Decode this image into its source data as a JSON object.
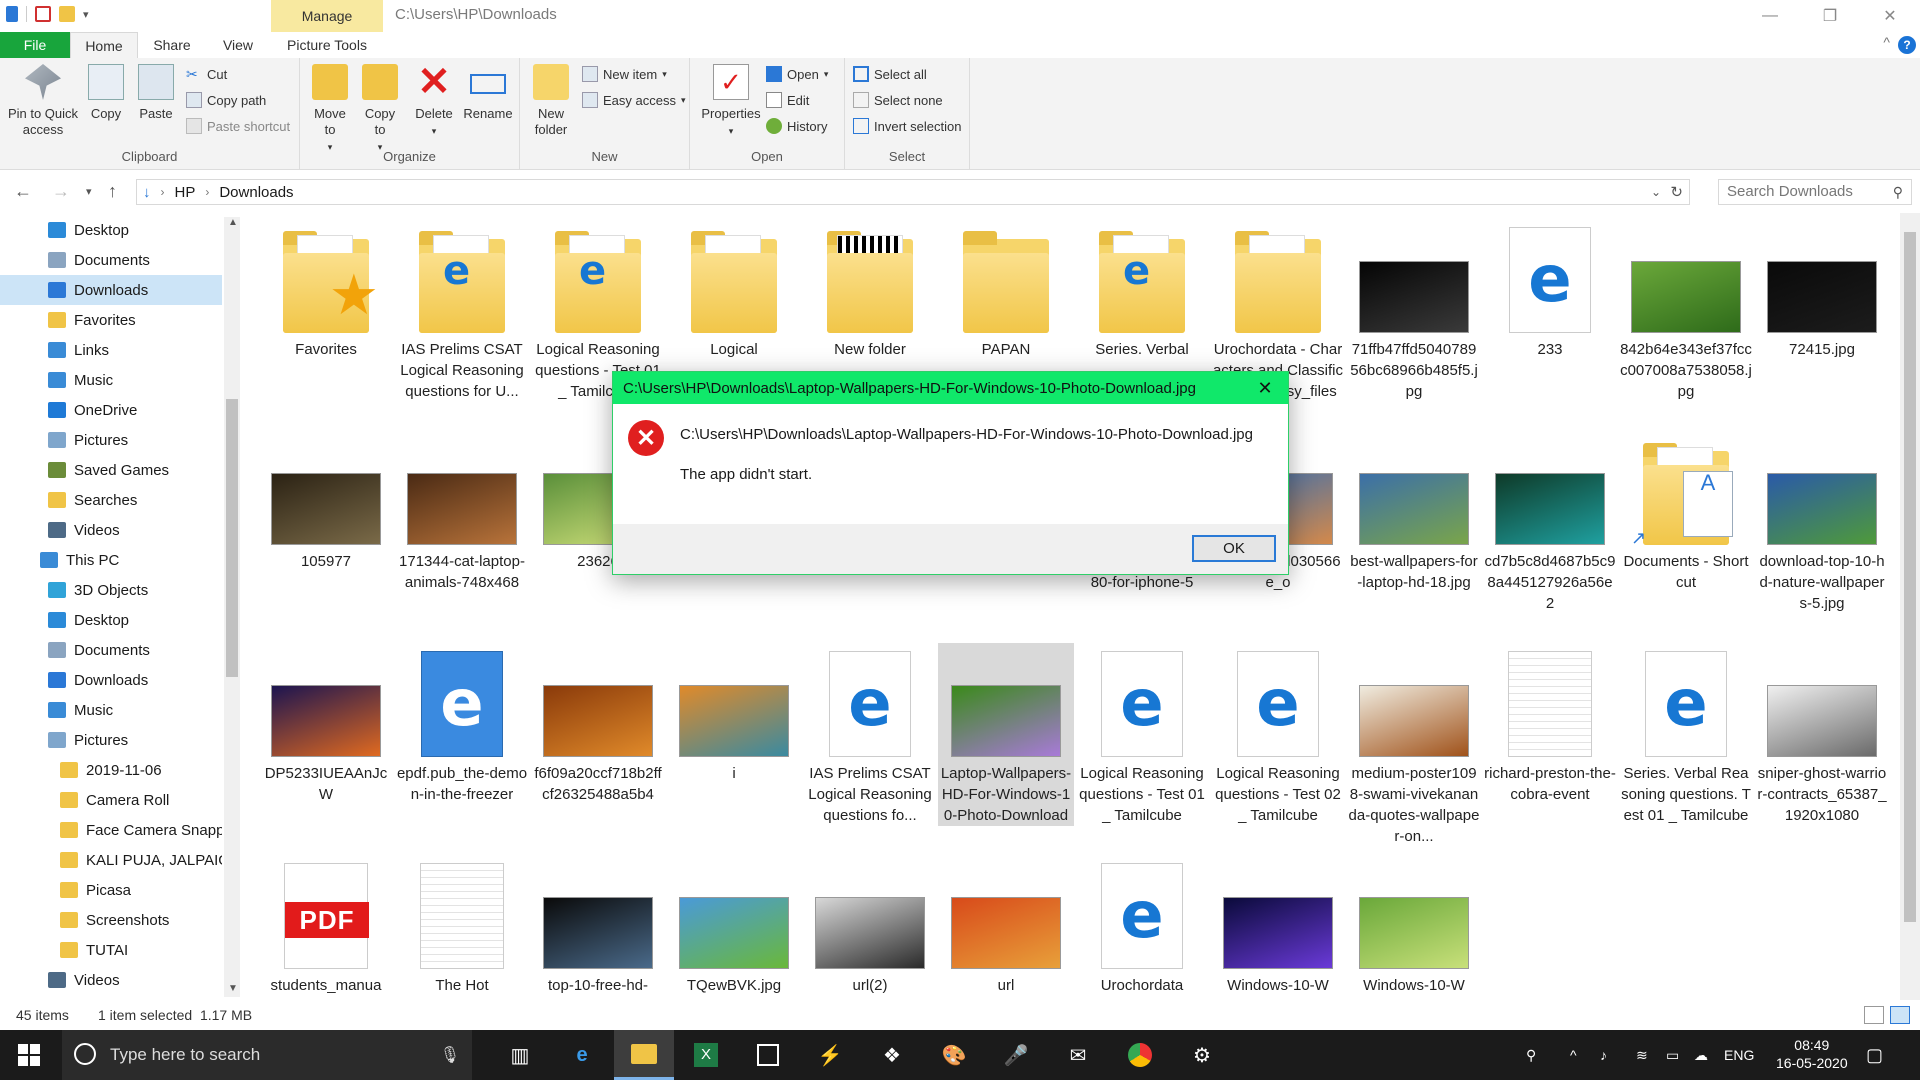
{
  "window": {
    "title_path": "C:\\Users\\HP\\Downloads",
    "manage_label": "Manage",
    "minimize": "—",
    "maximize": "❐",
    "close": "✕"
  },
  "tabs": {
    "file": "File",
    "home": "Home",
    "share": "Share",
    "view": "View",
    "picture_tools": "Picture Tools",
    "help": "?"
  },
  "ribbon": {
    "clipboard": {
      "label": "Clipboard",
      "pin": "Pin to Quick access",
      "copy": "Copy",
      "paste": "Paste",
      "cut": "Cut",
      "copy_path": "Copy path",
      "paste_shortcut": "Paste shortcut"
    },
    "organize": {
      "label": "Organize",
      "move_to": "Move to",
      "copy_to": "Copy to",
      "delete": "Delete",
      "rename": "Rename"
    },
    "new": {
      "label": "New",
      "new_folder": "New folder",
      "new_item": "New item",
      "easy_access": "Easy access"
    },
    "open": {
      "label": "Open",
      "properties": "Properties",
      "open": "Open",
      "edit": "Edit",
      "history": "History"
    },
    "select": {
      "label": "Select",
      "select_all": "Select all",
      "select_none": "Select none",
      "invert": "Invert selection"
    }
  },
  "address": {
    "crumb1": "HP",
    "crumb2": "Downloads",
    "search_placeholder": "Search Downloads"
  },
  "sidebar": {
    "items": [
      {
        "label": "Desktop",
        "icon": "desktop-icon",
        "color": "#2b8ad8"
      },
      {
        "label": "Documents",
        "icon": "documents-icon",
        "color": "#8aa4c0"
      },
      {
        "label": "Downloads",
        "icon": "downloads-icon",
        "color": "#2b78d6"
      },
      {
        "label": "Favorites",
        "icon": "folder-icon",
        "color": "#f0c446"
      },
      {
        "label": "Links",
        "icon": "links-icon",
        "color": "#3a8bd6"
      },
      {
        "label": "Music",
        "icon": "music-icon",
        "color": "#3a8bd6"
      },
      {
        "label": "OneDrive",
        "icon": "onedrive-icon",
        "color": "#1f7ad6"
      },
      {
        "label": "Pictures",
        "icon": "pictures-icon",
        "color": "#7fa6cc"
      },
      {
        "label": "Saved Games",
        "icon": "saved-games-icon",
        "color": "#6b8c3a"
      },
      {
        "label": "Searches",
        "icon": "searches-icon",
        "color": "#f0c446"
      },
      {
        "label": "Videos",
        "icon": "videos-icon",
        "color": "#4d6a86"
      },
      {
        "label": "This PC",
        "icon": "this-pc-icon",
        "color": "#3a8bd6"
      },
      {
        "label": "3D Objects",
        "icon": "3d-objects-icon",
        "color": "#30a3d8"
      },
      {
        "label": "Desktop",
        "icon": "desktop-icon",
        "color": "#2b8ad8"
      },
      {
        "label": "Documents",
        "icon": "documents-icon",
        "color": "#8aa4c0"
      },
      {
        "label": "Downloads",
        "icon": "downloads-icon",
        "color": "#2b78d6"
      },
      {
        "label": "Music",
        "icon": "music-icon",
        "color": "#3a8bd6"
      },
      {
        "label": "Pictures",
        "icon": "pictures-icon",
        "color": "#7fa6cc"
      },
      {
        "label": "2019-11-06",
        "icon": "folder-icon",
        "color": "#f0c446"
      },
      {
        "label": "Camera Roll",
        "icon": "folder-icon",
        "color": "#f0c446"
      },
      {
        "label": "Face Camera Snappy",
        "icon": "folder-icon",
        "color": "#f0c446"
      },
      {
        "label": "KALI PUJA, JALPAIGU",
        "icon": "folder-icon",
        "color": "#f0c446"
      },
      {
        "label": "Picasa",
        "icon": "folder-icon",
        "color": "#f0c446"
      },
      {
        "label": "Screenshots",
        "icon": "folder-icon",
        "color": "#f0c446"
      },
      {
        "label": "TUTAI",
        "icon": "folder-icon",
        "color": "#f0c446"
      },
      {
        "label": "Videos",
        "icon": "videos-icon",
        "color": "#4d6a86"
      }
    ]
  },
  "files": [
    {
      "name": "Favorites",
      "kind": "folder-star"
    },
    {
      "name": "IAS Prelims CSAT Logical Reasoning questions for U...",
      "kind": "folder-edge"
    },
    {
      "name": "Logical Reasoning questions - Test 01 _ Tamilcube",
      "kind": "folder-edge"
    },
    {
      "name": "Logical",
      "kind": "folder"
    },
    {
      "name": "New folder",
      "kind": "folder-qr"
    },
    {
      "name": "PAPAN",
      "kind": "folder-empty"
    },
    {
      "name": "Series. Verbal",
      "kind": "folder-edge"
    },
    {
      "name": "Urochordata - Characters and Classification _ Easy_files",
      "kind": "folder"
    },
    {
      "name": "71ffb47ffd504078956bc68966b485f5.jpg",
      "kind": "img",
      "c1": "#050505",
      "c2": "#3a3a3a"
    },
    {
      "name": "233",
      "kind": "edge"
    },
    {
      "name": "842b64e343ef37fccc007008a7538058.jpg",
      "kind": "img",
      "c1": "#6ba83a",
      "c2": "#2e6b1a"
    },
    {
      "name": "72415.jpg",
      "kind": "img",
      "c1": "#0a0a0a",
      "c2": "#1c1c1c"
    },
    {
      "name": "105977",
      "kind": "img",
      "c1": "#2b2214",
      "c2": "#7a6a48"
    },
    {
      "name": "171344-cat-laptop-animals-748x468",
      "kind": "img",
      "c1": "#4a2a14",
      "c2": "#b8733a"
    },
    {
      "name": "23626",
      "kind": "img",
      "c1": "#5a8f3a",
      "c2": "#cfe07a"
    },
    {
      "name": "",
      "kind": "hidden"
    },
    {
      "name": "",
      "kind": "hidden"
    },
    {
      "name": "",
      "kind": "hidden"
    },
    {
      "name": "-wallpaper-1920x1080-for-iphone-5",
      "kind": "img",
      "c1": "#2e6cc0",
      "c2": "#d7a060"
    },
    {
      "name": "02714_a2d030566e_o",
      "kind": "img",
      "c1": "#3a6fb0",
      "c2": "#d4894a"
    },
    {
      "name": "best-wallpapers-for-laptop-hd-18.jpg",
      "kind": "img",
      "c1": "#3b6fa8",
      "c2": "#7aa54a"
    },
    {
      "name": "cd7b5c8d4687b5c98a445127926a56e2",
      "kind": "img",
      "c1": "#0e3a28",
      "c2": "#1fa0a0"
    },
    {
      "name": "Documents - Shortcut",
      "kind": "folder-doc"
    },
    {
      "name": "download-top-10-hd-nature-wallpapers-5.jpg",
      "kind": "img",
      "c1": "#2a5aa8",
      "c2": "#4f9a3a"
    },
    {
      "name": "DP5233IUEAAnJcW",
      "kind": "img",
      "c1": "#1c1450",
      "c2": "#e06a20"
    },
    {
      "name": "epdf.pub_the-demon-in-the-freezer",
      "kind": "edge-book"
    },
    {
      "name": "f6f09a20ccf718b2ffcf26325488a5b4",
      "kind": "img",
      "c1": "#8a3a0a",
      "c2": "#e08a2a"
    },
    {
      "name": "i",
      "kind": "img",
      "c1": "#e08a2a",
      "c2": "#3a8aa0"
    },
    {
      "name": "IAS Prelims CSAT Logical Reasoning questions fo...",
      "kind": "edge"
    },
    {
      "name": "Laptop-Wallpapers-HD-For-Windows-10-Photo-Download",
      "kind": "img-sel",
      "c1": "#3a8a1a",
      "c2": "#a87ad8"
    },
    {
      "name": "Logical Reasoning questions - Test 01 _ Tamilcube",
      "kind": "edge"
    },
    {
      "name": "Logical Reasoning questions - Test 02 _ Tamilcube",
      "kind": "edge"
    },
    {
      "name": "medium-poster1098-swami-vivekananda-quotes-wallpaper-on...",
      "kind": "img",
      "c1": "#f0ece0",
      "c2": "#a0521a"
    },
    {
      "name": "richard-preston-the-cobra-event",
      "kind": "txt"
    },
    {
      "name": "Series. Verbal Reasoning questions. Test 01 _ Tamilcube",
      "kind": "edge"
    },
    {
      "name": "sniper-ghost-warrior-contracts_65387_1920x1080",
      "kind": "img",
      "c1": "#f0f0f0",
      "c2": "#6a6a6a"
    },
    {
      "name": "students_manua",
      "kind": "pdf"
    },
    {
      "name": "The Hot",
      "kind": "txt"
    },
    {
      "name": "top-10-free-hd-",
      "kind": "img",
      "c1": "#0a0a0a",
      "c2": "#4a6a8a"
    },
    {
      "name": "TQewBVK.jpg",
      "kind": "img",
      "c1": "#4a9ad8",
      "c2": "#6ab83a"
    },
    {
      "name": "url(2)",
      "kind": "img",
      "c1": "#d8d8d8",
      "c2": "#2a2a2a"
    },
    {
      "name": "url",
      "kind": "img",
      "c1": "#d84a1a",
      "c2": "#e8a03a"
    },
    {
      "name": "Urochordata",
      "kind": "edge"
    },
    {
      "name": "Windows-10-W",
      "kind": "img",
      "c1": "#0a0a3a",
      "c2": "#6a3ad8"
    },
    {
      "name": "Windows-10-W",
      "kind": "img",
      "c1": "#6aa83a",
      "c2": "#c8e07a"
    }
  ],
  "pdf_label": "PDF",
  "status": {
    "items": "45 items",
    "selected": "1 item selected  1.17 MB"
  },
  "dialog": {
    "title": "C:\\Users\\HP\\Downloads\\Laptop-Wallpapers-HD-For-Windows-10-Photo-Download.jpg",
    "message": "C:\\Users\\HP\\Downloads\\Laptop-Wallpapers-HD-For-Windows-10-Photo-Download.jpg",
    "submessage": "The app didn't start.",
    "ok": "OK",
    "close": "✕",
    "error_glyph": "✕"
  },
  "taskbar": {
    "search_placeholder": "Type here to search",
    "lang": "ENG",
    "time": "08:49",
    "date": "16-05-2020"
  }
}
